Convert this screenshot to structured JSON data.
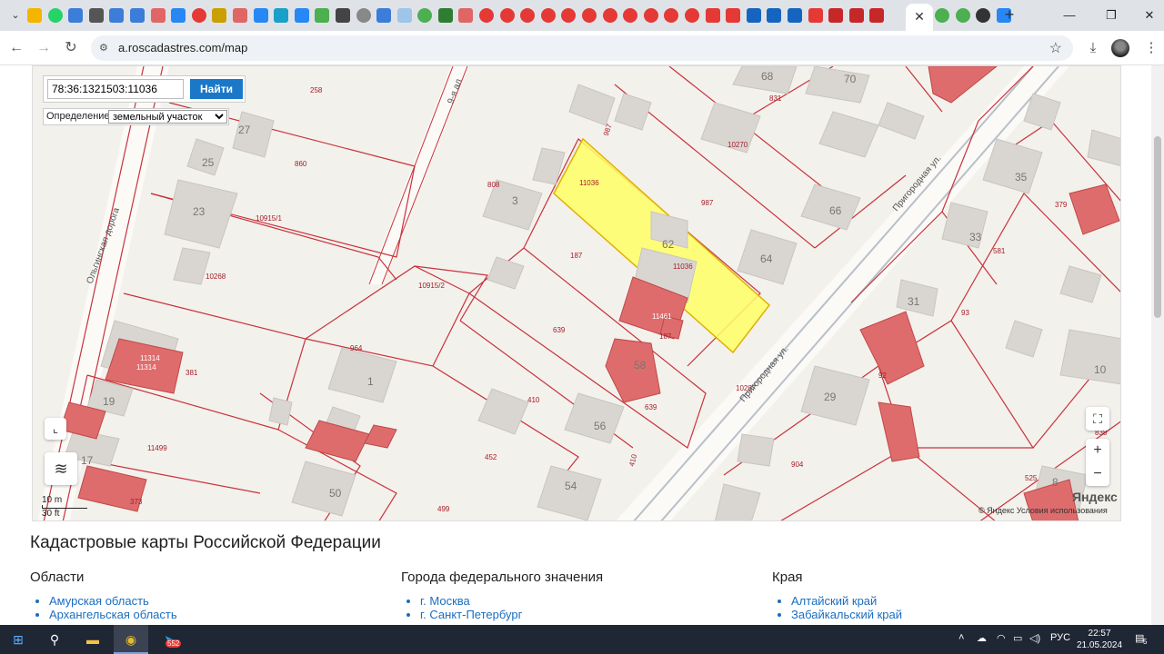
{
  "browser": {
    "tab_close": "✕",
    "new_tab": "+",
    "url": "a.roscadastres.com/map"
  },
  "map": {
    "search_value": "78:36:1321503:11036",
    "search_button": "Найти",
    "definition_label": "Определение:",
    "definition_value": "земельный участок",
    "scale_m": "10 m",
    "scale_ft": "30 ft",
    "yandex_logo": "Яндекс",
    "copyright": "© Яндекс  Условия использования",
    "highlight_color": "#ffff66",
    "parcel_line_color": "#c8323c",
    "labels": {
      "p258": "258",
      "p860": "860",
      "p10915_1": "10915/1",
      "p10268": "10268",
      "p808": "808",
      "p11036a": "11036",
      "p11036b": "11036",
      "p987a": "987",
      "p987b": "987",
      "p10270": "10270",
      "p831": "831",
      "p187a": "187",
      "p187b": "187",
      "p10915_2": "10915/2",
      "p639a": "639",
      "p639b": "639",
      "p964": "964",
      "p381": "381",
      "p410a": "410",
      "p410b": "410",
      "p11499": "11499",
      "p452": "452",
      "p499": "499",
      "p373": "373",
      "p10287": "10287",
      "p904": "904",
      "p93": "93",
      "p92": "92",
      "p581": "581",
      "p379": "379",
      "p838": "838",
      "p525": "525",
      "p11461": "11461",
      "p11314": "11314",
      "p11314b": "11314",
      "street1": "Пригородная ул.",
      "street2": "Пригородная ул.",
      "road": "Ольгинская дорога",
      "alley": "9-я ал"
    },
    "house_numbers": {
      "h27": "27",
      "h25": "25",
      "h23": "23",
      "h3": "3",
      "h62": "62",
      "h64": "64",
      "h66": "66",
      "h68": "68",
      "h70": "70",
      "h1": "1",
      "h19": "19",
      "h17": "17",
      "h50": "50",
      "h56": "56",
      "h54": "54",
      "h58": "58",
      "h29": "29",
      "h31": "31",
      "h33": "33",
      "h35": "35",
      "h10": "10",
      "h8": "8"
    }
  },
  "content": {
    "heading": "Кадастровые карты Российской Федерации",
    "col1_title": "Области",
    "col1_items": [
      "Амурская область",
      "Архангельская область"
    ],
    "col2_title": "Города федерального значения",
    "col2_items": [
      "г. Москва",
      "г. Санкт-Петербург"
    ],
    "col3_title": "Края",
    "col3_items": [
      "Алтайский край",
      "Забайкальский край"
    ]
  },
  "taskbar": {
    "telegram_badge": "552",
    "lang": "РУС",
    "time": "22:57",
    "date": "21.05.2024",
    "notif_count": "5"
  }
}
